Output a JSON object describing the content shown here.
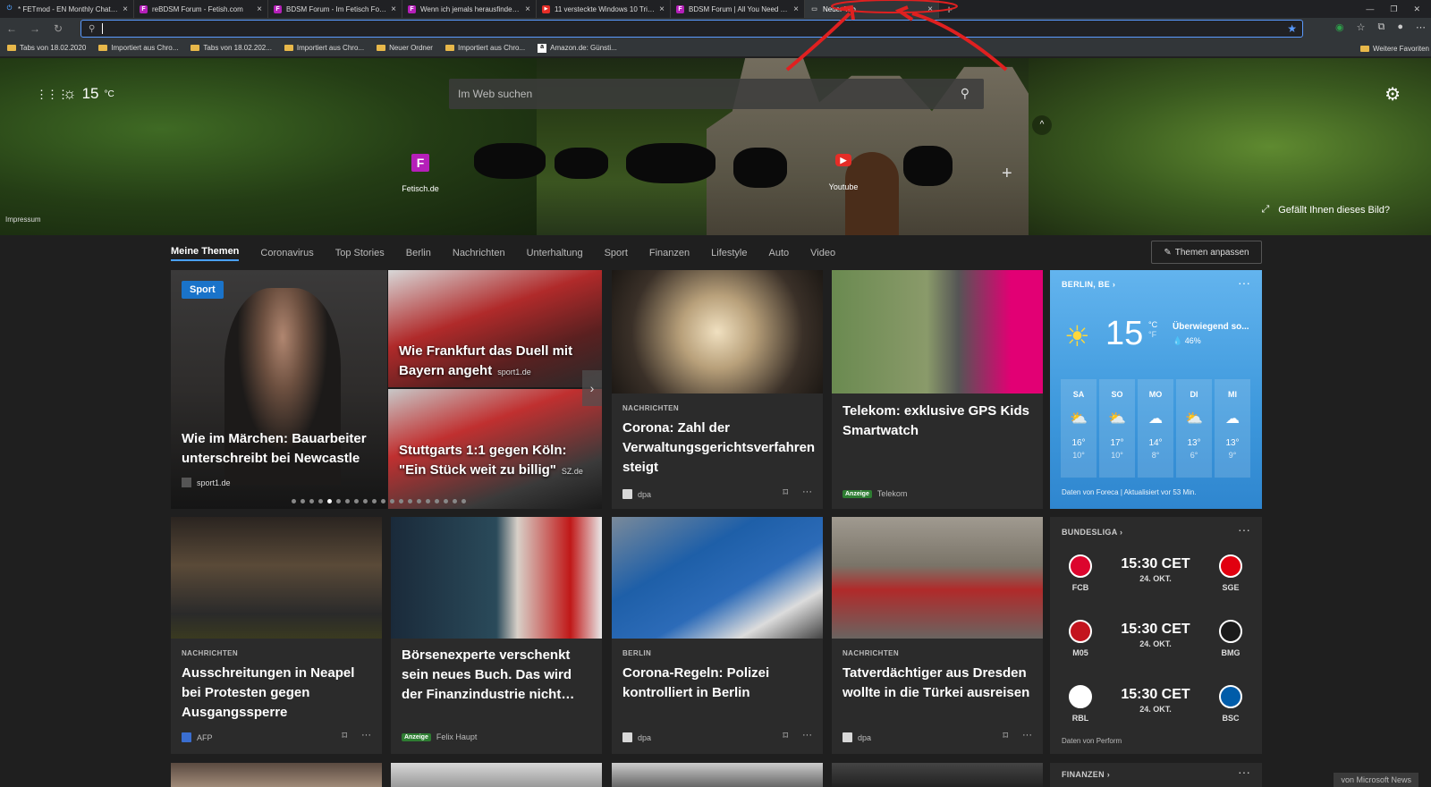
{
  "browser": {
    "tabs": [
      {
        "title": "* FETmod - EN Monthly Chat - V...",
        "icon_color": "#4a8fe0",
        "icon": "⏻"
      },
      {
        "title": "reBDSM Forum - Fetish.com",
        "icon_color": "#b51fb9",
        "icon": "F"
      },
      {
        "title": "BDSM Forum - Im Fetisch Forum...",
        "icon_color": "#b51fb9",
        "icon": "F"
      },
      {
        "title": "Wenn ich jemals herausfinde, w...",
        "icon_color": "#b51fb9",
        "icon": "F"
      },
      {
        "title": "11 versteckte Windows 10 Tricks...",
        "icon_color": "#e52d27",
        "icon": "▶"
      },
      {
        "title": "BDSM Forum | All You Need To K...",
        "icon_color": "#b51fb9",
        "icon": "F"
      },
      {
        "title": "Neuer Tab",
        "icon_color": "#777777",
        "icon": "▭",
        "active": true
      }
    ],
    "new_tab_icon": "plus-icon",
    "close_glyph": "×",
    "address_value": "",
    "bookmarks": [
      {
        "label": "Tabs von 18.02.2020",
        "icon": "folder-icon"
      },
      {
        "label": "Importiert aus Chro...",
        "icon": "folder-icon"
      },
      {
        "label": "Tabs von 18.02.202...",
        "icon": "folder-icon"
      },
      {
        "label": "Importiert aus Chro...",
        "icon": "folder-icon"
      },
      {
        "label": "Neuer Ordner",
        "icon": "folder-icon"
      },
      {
        "label": "Importiert aus Chro...",
        "icon": "folder-icon"
      },
      {
        "label": "Amazon.de: Günsti...",
        "icon": "amazon-icon"
      }
    ],
    "bookmarks_more": "Weitere Favoriten"
  },
  "header": {
    "temperature": "15",
    "temp_unit": "°C",
    "search_placeholder": "Im Web suchen",
    "tiles": [
      {
        "label": "Fetisch.de",
        "icon": "F",
        "color": "#b51fb9"
      },
      {
        "label": "Youtube",
        "icon": "▶",
        "color": "#e52d27"
      }
    ],
    "impressum": "Impressum",
    "like_image": "Gefällt Ihnen dieses Bild?"
  },
  "nav": {
    "items": [
      "Meine Themen",
      "Coronavirus",
      "Top Stories",
      "Berlin",
      "Nachrichten",
      "Unterhaltung",
      "Sport",
      "Finanzen",
      "Lifestyle",
      "Auto",
      "Video"
    ],
    "customize": "Themen anpassen"
  },
  "carousel": {
    "badge": "Sport",
    "main_title": "Wie im Märchen: Bauarbeiter unterschreibt bei Newcastle",
    "main_source": "sport1.de",
    "top_title": "Wie Frankfurt das Duell mit Bayern angeht",
    "top_source": "sport1.de",
    "bottom_title": "Stuttgarts 1:1 gegen Köln: \"Ein Stück weit zu billig\"",
    "bottom_source": "SZ.de",
    "dots_total": 20,
    "dots_active": 4
  },
  "cards": [
    {
      "category": "NACHRICHTEN",
      "title": "Corona: Zahl der Verwaltungsgerichtsverfahren steigt",
      "source": "dpa"
    },
    {
      "category": "",
      "title": "Telekom: exklusive GPS Kids Smartwatch",
      "source": "Telekom",
      "ad": "Anzeige"
    },
    {
      "category": "NACHRICHTEN",
      "title": "Ausschreitungen in Neapel bei Protesten gegen Ausgangssperre",
      "source": "AFP"
    },
    {
      "category": "",
      "title": "Börsenexperte verschenkt sein neues Buch. Das wird der Finanzindustrie nicht…",
      "source": "Felix Haupt",
      "ad": "Anzeige"
    },
    {
      "category": "BERLIN",
      "title": "Corona-Regeln: Polizei kontrolliert in Berlin",
      "source": "dpa"
    },
    {
      "category": "NACHRICHTEN",
      "title": "Tatverdächtiger aus Dresden wollte in die Türkei ausreisen",
      "source": "dpa"
    }
  ],
  "weather": {
    "location": "BERLIN, BE",
    "temp": "15",
    "unit_c": "°C",
    "unit_f": "°F",
    "condition": "Überwiegend so...",
    "humidity": "46%",
    "days": [
      {
        "day": "SA",
        "hi": "16°",
        "lo": "10°",
        "icon": "partly-cloudy-icon"
      },
      {
        "day": "SO",
        "hi": "17°",
        "lo": "10°",
        "icon": "partly-cloudy-icon"
      },
      {
        "day": "MO",
        "hi": "14°",
        "lo": "8°",
        "icon": "cloudy-icon"
      },
      {
        "day": "DI",
        "hi": "13°",
        "lo": "6°",
        "icon": "partly-cloudy-icon"
      },
      {
        "day": "MI",
        "hi": "13°",
        "lo": "9°",
        "icon": "cloudy-icon"
      }
    ],
    "footer": "Daten von Foreca | Aktualisiert vor 53 Min."
  },
  "bundesliga": {
    "header": "BUNDESLIGA",
    "matches": [
      {
        "home": "FCB",
        "away": "SGE",
        "time": "15:30 CET",
        "date": "24. OKT.",
        "home_color": "#dc052d",
        "away_color": "#e1000f"
      },
      {
        "home": "M05",
        "away": "BMG",
        "time": "15:30 CET",
        "date": "24. OKT.",
        "home_color": "#c3141e",
        "away_color": "#1a1a1a"
      },
      {
        "home": "RBL",
        "away": "BSC",
        "time": "15:30 CET",
        "date": "24. OKT.",
        "home_color": "#ffffff",
        "away_color": "#005ca9"
      }
    ],
    "footer": "Daten von Perform"
  },
  "finanzen": {
    "header": "FINANZEN"
  },
  "msn": "von Microsoft News",
  "more_glyph": "···"
}
